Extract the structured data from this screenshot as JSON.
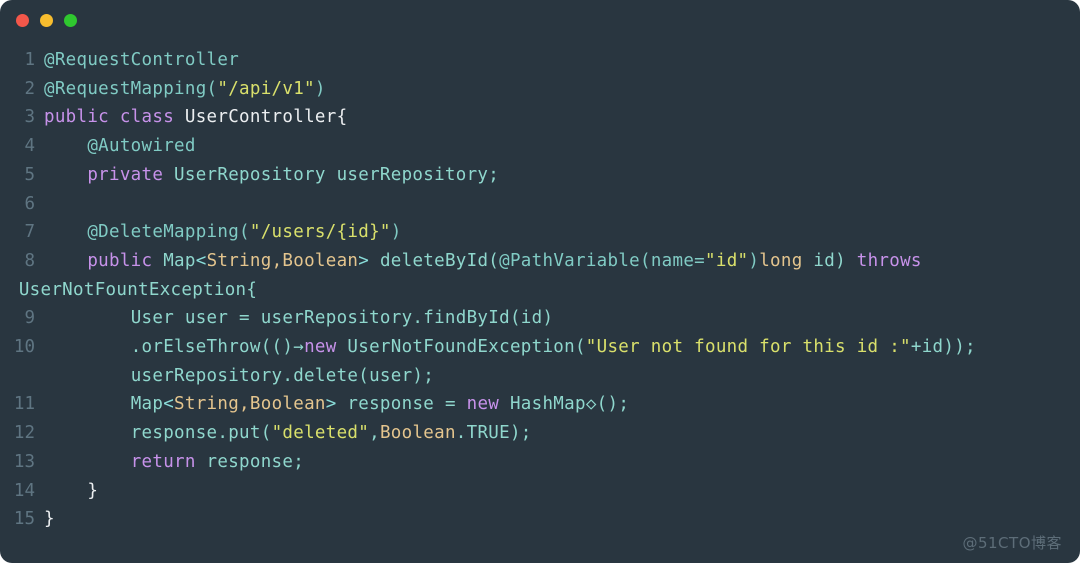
{
  "window": {
    "traffic_lights": [
      {
        "name": "close",
        "color": "#f3574a"
      },
      {
        "name": "minimize",
        "color": "#f7bd2e"
      },
      {
        "name": "maximize",
        "color": "#2fc82f"
      }
    ],
    "background": "#293640"
  },
  "editor": {
    "language": "java",
    "gutter_numbers": [
      "1",
      "2",
      "3",
      "4",
      "5",
      "6",
      "7",
      "8",
      "",
      "9",
      "10",
      "",
      "11",
      "12",
      "13",
      "14",
      "15"
    ],
    "lines": [
      {
        "num": "1",
        "text": "@RequestController"
      },
      {
        "num": "2",
        "text": "@RequestMapping(\"/api/v1\")"
      },
      {
        "num": "3",
        "text": "public class UserController{"
      },
      {
        "num": "4",
        "text": "    @Autowired"
      },
      {
        "num": "5",
        "text": "    private UserRepository userRepository;"
      },
      {
        "num": "6",
        "text": ""
      },
      {
        "num": "7",
        "text": "    @DeleteMapping(\"/users/{id}\")"
      },
      {
        "num": "8",
        "text": "    public Map<String,Boolean> deleteById(@PathVariable(name=\"id\")long id) throws"
      },
      {
        "num": "",
        "text": " UserNotFountException{"
      },
      {
        "num": "9",
        "text": "        User user = userRepository.findById(id)"
      },
      {
        "num": "10",
        "text": "        .orElseThrow(()→new UserNotFoundException(\"User not found for this id :\"+id));"
      },
      {
        "num": "",
        "text": "        userRepository.delete(user);"
      },
      {
        "num": "11",
        "text": "        Map<String,Boolean> response = new HashMap<>();"
      },
      {
        "num": "12",
        "text": "        response.put(\"deleted\",Boolean.TRUE);"
      },
      {
        "num": "13",
        "text": "        return response;"
      },
      {
        "num": "14",
        "text": "    }"
      },
      {
        "num": "15",
        "text": "}"
      }
    ]
  },
  "watermark": {
    "text": "@51CTO博客"
  },
  "colors": {
    "keyword": "#c792ea",
    "annotation": "#80cbc4",
    "string": "#d9e06b",
    "type": "#e4c58e",
    "default": "#8fd7cd",
    "gutter": "#5f7582",
    "class_name": "#eceff1"
  }
}
